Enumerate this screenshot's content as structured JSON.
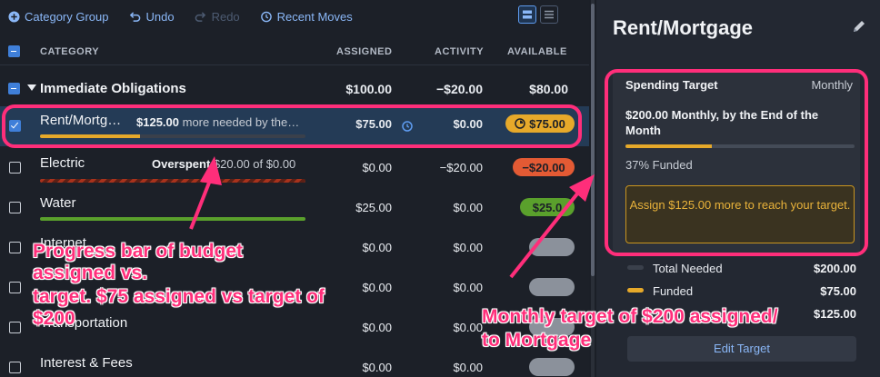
{
  "toolbar": {
    "category_group": "Category Group",
    "undo": "Undo",
    "redo": "Redo",
    "recent_moves": "Recent Moves"
  },
  "columns": {
    "category": "CATEGORY",
    "assigned": "ASSIGNED",
    "activity": "ACTIVITY",
    "available": "AVAILABLE"
  },
  "group": {
    "name": "Immediate Obligations",
    "assigned": "$100.00",
    "activity": "−$20.00",
    "available": "$80.00"
  },
  "rows": [
    {
      "name": "Rent/Mortg…",
      "msg_amount": "$125.00",
      "msg_text": " more needed by the…",
      "assigned": "$75.00",
      "activity": "$0.00",
      "available": "$75.00",
      "progress": 0.375
    },
    {
      "name": "Electric",
      "msg_bold": "Overspent",
      "msg_text": " $20.00 of $0.00",
      "assigned": "$0.00",
      "activity": "−$20.00",
      "available": "−$20.00"
    },
    {
      "name": "Water",
      "assigned": "$25.00",
      "activity": "$0.00",
      "available": "$25.0",
      "progress": 1.0
    },
    {
      "name": "Internet",
      "assigned": "$0.00",
      "activity": "$0.00",
      "available": ""
    },
    {
      "name": "",
      "assigned": "$0.00",
      "activity": "$0.00",
      "available": ""
    },
    {
      "name": "Transportation",
      "assigned": "$0.00",
      "activity": "$0.00",
      "available": ""
    },
    {
      "name": "Interest & Fees",
      "assigned": "$0.00",
      "activity": "$0.00",
      "available": ""
    }
  ],
  "inspector": {
    "title": "Rent/Mortgage",
    "spending_target": "Spending Target",
    "frequency": "Monthly",
    "description": "$200.00 Monthly, by the End of the Month",
    "funded_pct": "37% Funded",
    "funded_fraction": 0.375,
    "assign_msg": "Assign $125.00 more to reach your target.",
    "total_needed_label": "Total Needed",
    "total_needed_value": "$200.00",
    "funded_label": "Funded",
    "funded_value": "$75.00",
    "third_value": "$125.00",
    "edit_target": "Edit Target"
  },
  "annotations": {
    "left_line1": "Progress bar of budget",
    "left_line2": "assigned vs.",
    "left_line3": "target. $75 assigned vs target of",
    "left_line4": "$200",
    "right_line1": "Monthly target of $200 assigned/",
    "right_line2": "to Mortgage"
  },
  "colors": {
    "accent": "#3f7fd9",
    "annotation": "#ff2e7a",
    "target_yellow": "#e6a92a",
    "overspent_red": "#e35a34",
    "funded_green": "#5aa02c"
  }
}
